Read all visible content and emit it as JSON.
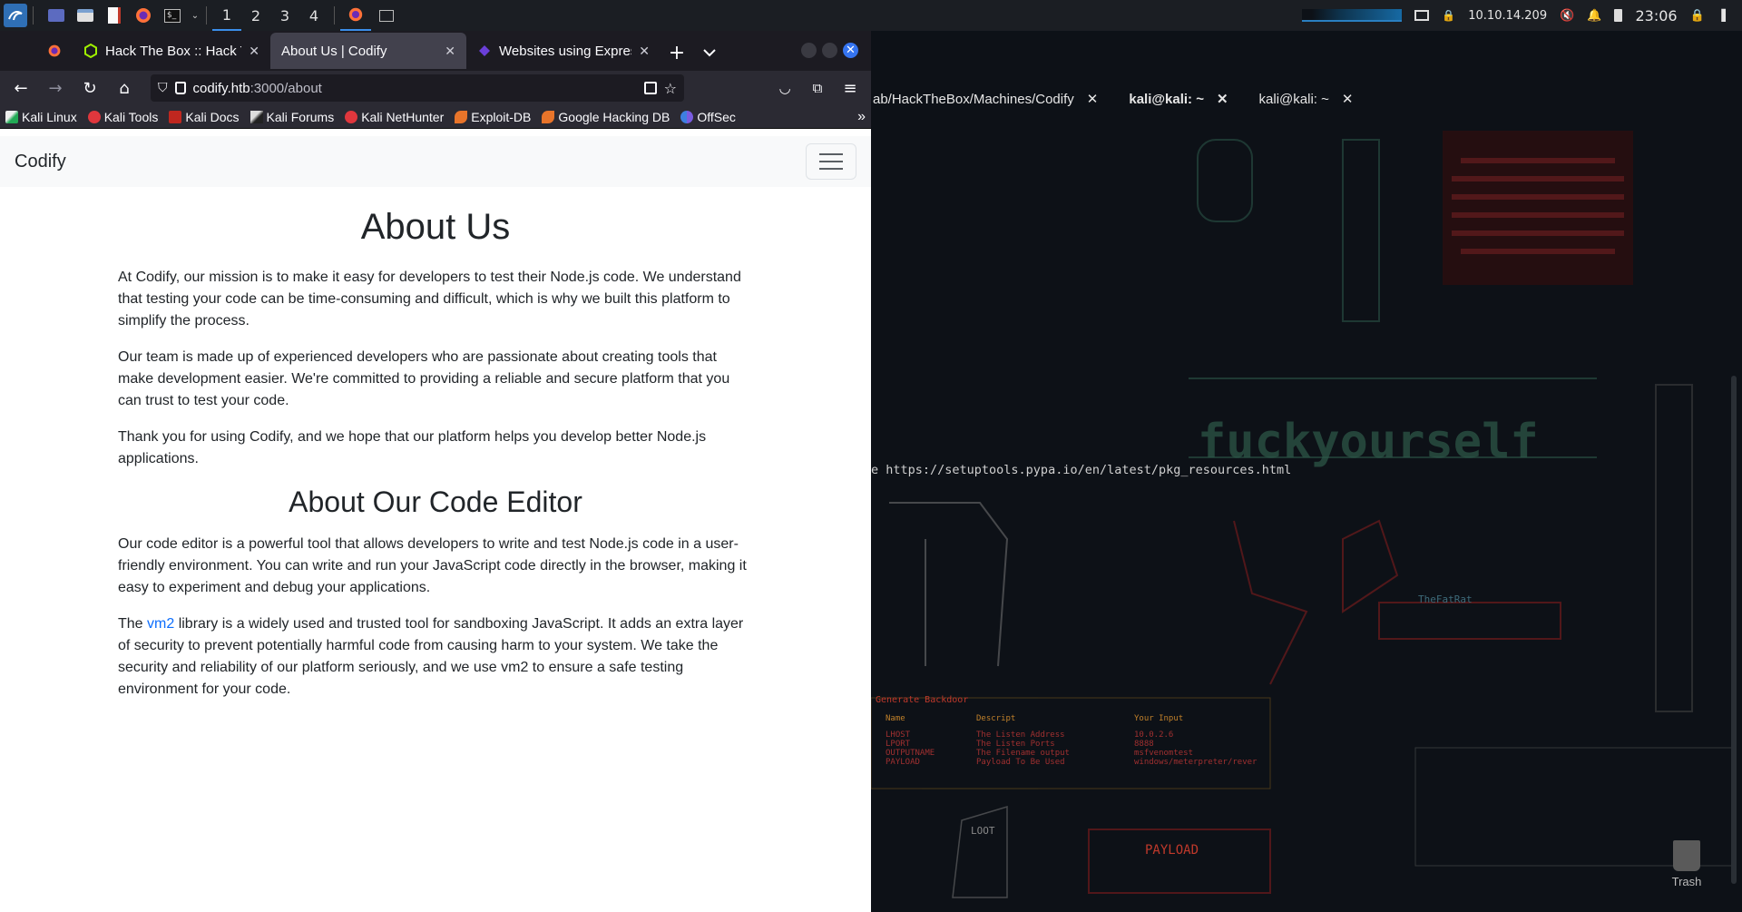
{
  "panel": {
    "workspaces": [
      "1",
      "2",
      "3",
      "4"
    ],
    "ip": "10.10.14.209",
    "clock": "23:06"
  },
  "browser": {
    "tabs": [
      {
        "title": "Hack The Box :: Hack The"
      },
      {
        "title": "About Us | Codify"
      },
      {
        "title": "Websites using Express -"
      }
    ],
    "url_host": "codify.htb",
    "url_path": ":3000/about",
    "bookmarks": [
      "Kali Linux",
      "Kali Tools",
      "Kali Docs",
      "Kali Forums",
      "Kali NetHunter",
      "Exploit-DB",
      "Google Hacking DB",
      "OffSec"
    ]
  },
  "page": {
    "brand": "Codify",
    "h1": "About Us",
    "p1": "At Codify, our mission is to make it easy for developers to test their Node.js code. We understand that testing your code can be time-consuming and difficult, which is why we built this platform to simplify the process.",
    "p2": "Our team is made up of experienced developers who are passionate about creating tools that make development easier. We're committed to providing a reliable and secure platform that you can trust to test your code.",
    "p3": "Thank you for using Codify, and we hope that our platform helps you develop better Node.js applications.",
    "h2": "About Our Code Editor",
    "p4": "Our code editor is a powerful tool that allows developers to write and test Node.js code in a user-friendly environment. You can write and run your JavaScript code directly in the browser, making it easy to experiment and debug your applications.",
    "p5_pre": "The ",
    "p5_link": "vm2",
    "p5_post": " library is a widely used and trusted tool for sandboxing JavaScript. It adds an extra layer of security to prevent potentially harmful code from causing harm to your system. We take the security and reliability of our platform seriously, and we use vm2 to ensure a safe testing environment for your code."
  },
  "terminal": {
    "tabs": [
      "ab/HackTheBox/Machines/Codify",
      "kali@kali: ~",
      "kali@kali: ~"
    ],
    "line": "e https://setuptools.pypa.io/en/latest/pkg_resources.html",
    "wallpaper_text": [
      "fuckyourself",
      "TheFatRat",
      "PAYLOAD",
      "LOOT",
      "Generate Backdoor"
    ],
    "table_headers": [
      "Name",
      "Descript",
      "Your Input"
    ],
    "table_rows": [
      [
        "LHOST",
        "The Listen Address",
        "10.0.2.6"
      ],
      [
        "LPORT",
        "The Listen Ports",
        "8888"
      ],
      [
        "OUTPUTNAME",
        "The Filename output",
        "msfvenomtest"
      ],
      [
        "PAYLOAD",
        "Payload To Be Used",
        "windows/meterpreter/rever"
      ]
    ],
    "trash_label": "Trash"
  },
  "colors": {
    "accent": "#3b8eea",
    "link": "#0d6efd",
    "terminal_bg": "#0d1117",
    "wallpaper_red": "#8b1e1e",
    "wallpaper_green": "#2e5a4a"
  }
}
